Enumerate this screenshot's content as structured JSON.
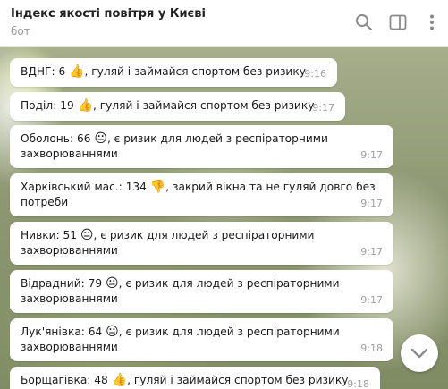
{
  "header": {
    "title": "Індекс якості повітря у Києві",
    "subtitle": "бот",
    "icons": [
      "search-icon",
      "sidebar-toggle-icon",
      "more-icon"
    ]
  },
  "messages": [
    {
      "district": "ВДНГ: 6",
      "emoji": "👍",
      "text": ", гуляй і займайся спортом без ризику",
      "time": "9:16"
    },
    {
      "district": "Поділ: 19",
      "emoji": "👍",
      "text": ", гуляй і займайся спортом без ризику",
      "time": "9:17"
    },
    {
      "district": "Оболонь: 66",
      "emoji": "😐",
      "text": ", є ризик для людей з респіраторними захворюваннями",
      "time": "9:17"
    },
    {
      "district": "Харківський мас.: 134",
      "emoji": "👎",
      "text": ", закрий вікна та не гуляй довго без потреби",
      "time": "9:17"
    },
    {
      "district": "Нивки: 51",
      "emoji": "😐",
      "text": ", є ризик для людей з респіраторними захворюваннями",
      "time": "9:17"
    },
    {
      "district": "Відрадний: 79",
      "emoji": "😐",
      "text": ", є ризик для людей з респіраторними захворюваннями",
      "time": "9:17"
    },
    {
      "district": "Лук'янівка: 64",
      "emoji": "😐",
      "text": ", є ризик для людей з респіраторними захворюваннями",
      "time": "9:18"
    },
    {
      "district": "Борщагівка: 48",
      "emoji": "👍",
      "text": ", гуляй і займайся спортом без ризику",
      "time": "9:18"
    }
  ],
  "scroll_button": {
    "icon": "chevron-down-icon"
  }
}
